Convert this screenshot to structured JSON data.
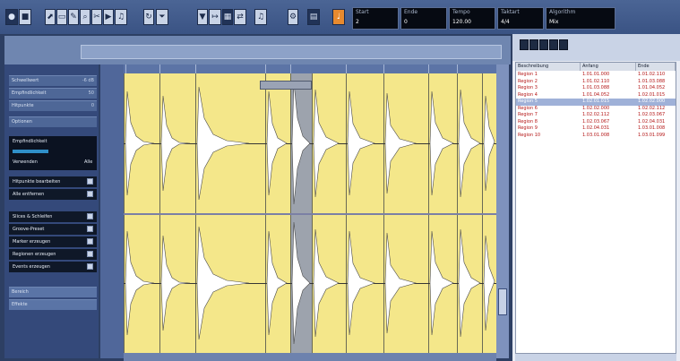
{
  "toolbar": {
    "buttons": [
      "",
      "",
      "",
      "",
      "",
      "",
      ""
    ],
    "info_boxes": [
      {
        "label": "Start",
        "value": "2"
      },
      {
        "label": "Ende",
        "value": "0"
      },
      {
        "label": "Tempo",
        "value": "120.00"
      },
      {
        "label": "Taktart",
        "value": "4/4"
      },
      {
        "label": "Algorithm",
        "value": "Mix"
      }
    ]
  },
  "overview": {
    "ticks": [
      "",
      "",
      "",
      "",
      "",
      "",
      "",
      "",
      ""
    ]
  },
  "left_panel": {
    "top_rows": [
      {
        "label": "Schwellwert",
        "value": "-6 dB"
      },
      {
        "label": "Empfindlichkeit",
        "value": "50"
      },
      {
        "label": "Hitpunkte",
        "value": "0"
      },
      {
        "label": "Optionen",
        "value": ""
      }
    ],
    "quantize": {
      "label": "Empfindlichkeit",
      "sub_label": "Verwenden",
      "sub_value": "Alle"
    },
    "mid_buttons": [
      "Hitpunkte bearbeiten",
      "Alle entfernen"
    ],
    "action_buttons": [
      "Slices & Schleifen",
      "Groove-Preset",
      "Marker erzeugen",
      "Regionen erzeugen",
      "Events erzeugen"
    ],
    "bottom_rows": [
      "Bereich",
      "Effekte"
    ]
  },
  "regions_table": {
    "headers": [
      "Beschreibung",
      "Anfang",
      "Ende"
    ],
    "rows": [
      {
        "name": "Region 1",
        "start": "1.01.01.000",
        "end": "1.01.02.110"
      },
      {
        "name": "Region 2",
        "start": "1.01.02.110",
        "end": "1.01.03.088"
      },
      {
        "name": "Region 3",
        "start": "1.01.03.088",
        "end": "1.01.04.052"
      },
      {
        "name": "Region 4",
        "start": "1.01.04.052",
        "end": "1.02.01.015"
      },
      {
        "name": "Region 5",
        "start": "1.02.01.015",
        "end": "1.02.02.000"
      },
      {
        "name": "Region 6",
        "start": "1.02.02.000",
        "end": "1.02.02.112"
      },
      {
        "name": "Region 7",
        "start": "1.02.02.112",
        "end": "1.02.03.067"
      },
      {
        "name": "Region 8",
        "start": "1.02.03.067",
        "end": "1.02.04.031"
      },
      {
        "name": "Region 9",
        "start": "1.02.04.031",
        "end": "1.03.01.008"
      },
      {
        "name": "Region 10",
        "start": "1.03.01.008",
        "end": "1.03.01.099"
      }
    ]
  },
  "colors": {
    "accent": "#e88a2e",
    "waveform_bg": "#f4e78a",
    "selection": "#9fb1d8",
    "region_text": "#b41616"
  }
}
